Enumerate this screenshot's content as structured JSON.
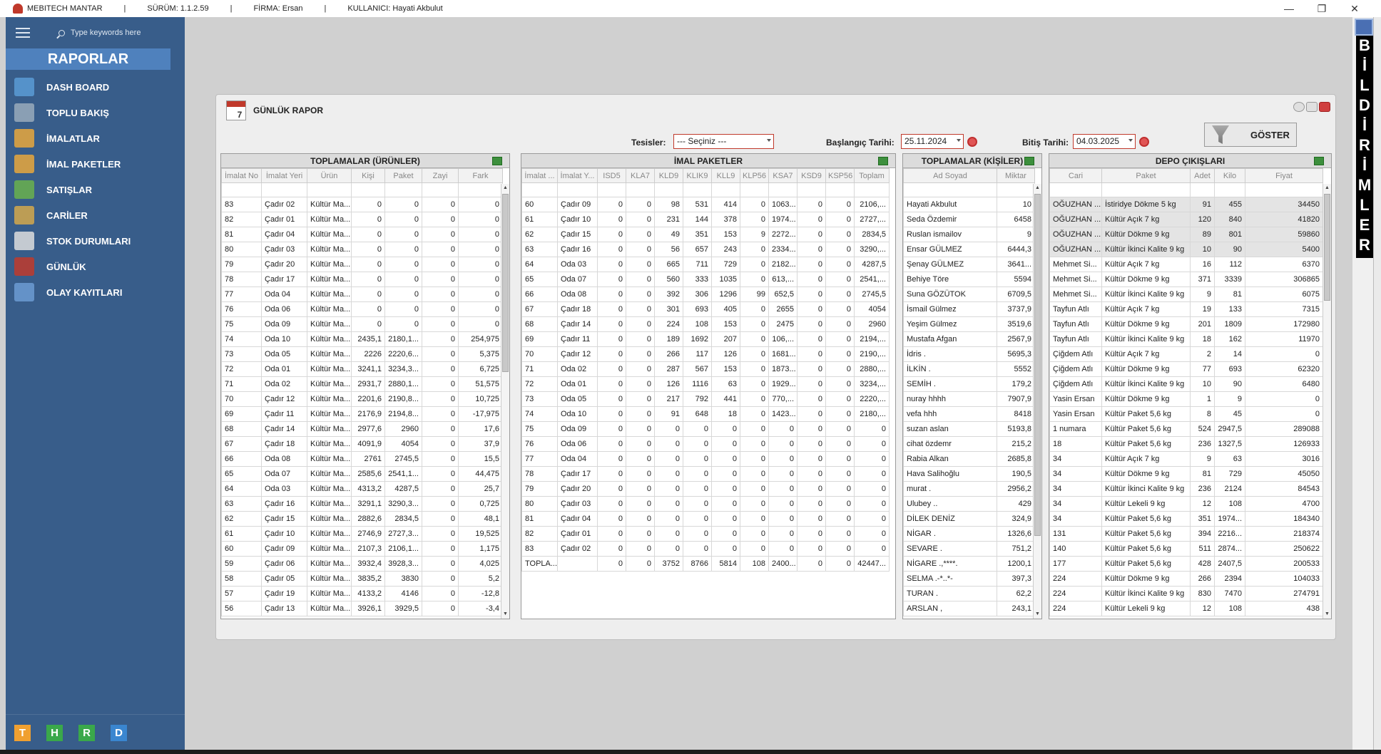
{
  "titlebar": {
    "app": "MEBITECH MANTAR",
    "sep": "|",
    "version": "SÜRÜM: 1.1.2.59",
    "company": "FİRMA: Ersan",
    "user": "KULLANICI: Hayati Akbulut",
    "min": "—",
    "max": "❐",
    "close": "✕"
  },
  "sidebar": {
    "search_placeholder": "Type keywords here",
    "header": "RAPORLAR",
    "items": [
      {
        "label": "DASH BOARD",
        "icon": "bar-chart-icon"
      },
      {
        "label": "TOPLU BAKIŞ",
        "icon": "overview-icon"
      },
      {
        "label": "İMALATLAR",
        "icon": "box-icon"
      },
      {
        "label": "İMAL PAKETLER",
        "icon": "boxes-icon"
      },
      {
        "label": "SATIŞLAR",
        "icon": "coins-icon"
      },
      {
        "label": "CARİLER",
        "icon": "people-icon"
      },
      {
        "label": "STOK DURUMLARI",
        "icon": "list-icon"
      },
      {
        "label": "GÜNLÜK",
        "icon": "calendar-icon"
      },
      {
        "label": "OLAY KAYITLARI",
        "icon": "film-icon"
      }
    ],
    "bottom": [
      {
        "label": "T",
        "color": "#f0a030"
      },
      {
        "label": "H",
        "color": "#3aa84a"
      },
      {
        "label": "R",
        "color": "#3aa84a"
      },
      {
        "label": "D",
        "color": "#3a86d0"
      }
    ]
  },
  "notify": {
    "letters": [
      "B",
      "İ",
      "L",
      "D",
      "İ",
      "R",
      "İ",
      "M",
      "L",
      "E",
      "R"
    ]
  },
  "report": {
    "title": "GÜNLÜK RAPOR",
    "cal_num": "7",
    "filters": {
      "tesisler_label": "Tesisler:",
      "tesisler_value": "--- Seçiniz ---",
      "start_label": "Başlangıç Tarihi:",
      "start_value": "25.11.2024",
      "end_label": "Bitiş Tarihi:",
      "end_value": "04.03.2025",
      "show_button": "GÖSTER"
    }
  },
  "grid1": {
    "title": "TOPLAMALAR (ÜRÜNLER)",
    "columns": [
      "İmalat No",
      "İmalat Yeri",
      "Ürün",
      "Kişi",
      "Paket",
      "Zayi",
      "Fark"
    ],
    "rows": [
      [
        "83",
        "Çadır 02",
        "Kültür Ma...",
        "0",
        "0",
        "0",
        "0"
      ],
      [
        "82",
        "Çadır 01",
        "Kültür Ma...",
        "0",
        "0",
        "0",
        "0"
      ],
      [
        "81",
        "Çadır 04",
        "Kültür Ma...",
        "0",
        "0",
        "0",
        "0"
      ],
      [
        "80",
        "Çadır 03",
        "Kültür Ma...",
        "0",
        "0",
        "0",
        "0"
      ],
      [
        "79",
        "Çadır 20",
        "Kültür Ma...",
        "0",
        "0",
        "0",
        "0"
      ],
      [
        "78",
        "Çadır 17",
        "Kültür Ma...",
        "0",
        "0",
        "0",
        "0"
      ],
      [
        "77",
        "Oda 04",
        "Kültür Ma...",
        "0",
        "0",
        "0",
        "0"
      ],
      [
        "76",
        "Oda 06",
        "Kültür Ma...",
        "0",
        "0",
        "0",
        "0"
      ],
      [
        "75",
        "Oda 09",
        "Kültür Ma...",
        "0",
        "0",
        "0",
        "0"
      ],
      [
        "74",
        "Oda 10",
        "Kültür Ma...",
        "2435,1",
        "2180,1...",
        "0",
        "254,975"
      ],
      [
        "73",
        "Oda 05",
        "Kültür Ma...",
        "2226",
        "2220,6...",
        "0",
        "5,375"
      ],
      [
        "72",
        "Oda 01",
        "Kültür Ma...",
        "3241,1",
        "3234,3...",
        "0",
        "6,725"
      ],
      [
        "71",
        "Oda 02",
        "Kültür Ma...",
        "2931,7",
        "2880,1...",
        "0",
        "51,575"
      ],
      [
        "70",
        "Çadır 12",
        "Kültür Ma...",
        "2201,6",
        "2190,8...",
        "0",
        "10,725"
      ],
      [
        "69",
        "Çadır 11",
        "Kültür Ma...",
        "2176,9",
        "2194,8...",
        "0",
        "-17,975"
      ],
      [
        "68",
        "Çadır 14",
        "Kültür Ma...",
        "2977,6",
        "2960",
        "0",
        "17,6"
      ],
      [
        "67",
        "Çadır 18",
        "Kültür Ma...",
        "4091,9",
        "4054",
        "0",
        "37,9"
      ],
      [
        "66",
        "Oda 08",
        "Kültür Ma...",
        "2761",
        "2745,5",
        "0",
        "15,5"
      ],
      [
        "65",
        "Oda 07",
        "Kültür Ma...",
        "2585,6",
        "2541,1...",
        "0",
        "44,475"
      ],
      [
        "64",
        "Oda 03",
        "Kültür Ma...",
        "4313,2",
        "4287,5",
        "0",
        "25,7"
      ],
      [
        "63",
        "Çadır 16",
        "Kültür Ma...",
        "3291,1",
        "3290,3...",
        "0",
        "0,725"
      ],
      [
        "62",
        "Çadır 15",
        "Kültür Ma...",
        "2882,6",
        "2834,5",
        "0",
        "48,1"
      ],
      [
        "61",
        "Çadır 10",
        "Kültür Ma...",
        "2746,9",
        "2727,3...",
        "0",
        "19,525"
      ],
      [
        "60",
        "Çadır 09",
        "Kültür Ma...",
        "2107,3",
        "2106,1...",
        "0",
        "1,175"
      ],
      [
        "59",
        "Çadır 06",
        "Kültür Ma...",
        "3932,4",
        "3928,3...",
        "0",
        "4,025"
      ],
      [
        "58",
        "Çadır 05",
        "Kültür Ma...",
        "3835,2",
        "3830",
        "0",
        "5,2"
      ],
      [
        "57",
        "Çadır 19",
        "Kültür Ma...",
        "4133,2",
        "4146",
        "0",
        "-12,8"
      ],
      [
        "56",
        "Çadır 13",
        "Kültür Ma...",
        "3926,1",
        "3929,5",
        "0",
        "-3,4"
      ]
    ]
  },
  "grid2": {
    "title": "İMAL PAKETLER",
    "columns": [
      "İmalat ...",
      "İmalat Y...",
      "ISD5",
      "KLA7",
      "KLD9",
      "KLIK9",
      "KLL9",
      "KLP56",
      "KSA7",
      "KSD9",
      "KSP56",
      "Toplam"
    ],
    "rows": [
      [
        "60",
        "Çadır 09",
        "0",
        "0",
        "98",
        "531",
        "414",
        "0",
        "1063...",
        "0",
        "0",
        "2106,..."
      ],
      [
        "61",
        "Çadır 10",
        "0",
        "0",
        "231",
        "144",
        "378",
        "0",
        "1974...",
        "0",
        "0",
        "2727,..."
      ],
      [
        "62",
        "Çadır 15",
        "0",
        "0",
        "49",
        "351",
        "153",
        "9",
        "2272...",
        "0",
        "0",
        "2834,5"
      ],
      [
        "63",
        "Çadır 16",
        "0",
        "0",
        "56",
        "657",
        "243",
        "0",
        "2334...",
        "0",
        "0",
        "3290,..."
      ],
      [
        "64",
        "Oda 03",
        "0",
        "0",
        "665",
        "711",
        "729",
        "0",
        "2182...",
        "0",
        "0",
        "4287,5"
      ],
      [
        "65",
        "Oda 07",
        "0",
        "0",
        "560",
        "333",
        "1035",
        "0",
        "613,...",
        "0",
        "0",
        "2541,..."
      ],
      [
        "66",
        "Oda 08",
        "0",
        "0",
        "392",
        "306",
        "1296",
        "99",
        "652,5",
        "0",
        "0",
        "2745,5"
      ],
      [
        "67",
        "Çadır 18",
        "0",
        "0",
        "301",
        "693",
        "405",
        "0",
        "2655",
        "0",
        "0",
        "4054"
      ],
      [
        "68",
        "Çadır 14",
        "0",
        "0",
        "224",
        "108",
        "153",
        "0",
        "2475",
        "0",
        "0",
        "2960"
      ],
      [
        "69",
        "Çadır 11",
        "0",
        "0",
        "189",
        "1692",
        "207",
        "0",
        "106,...",
        "0",
        "0",
        "2194,..."
      ],
      [
        "70",
        "Çadır 12",
        "0",
        "0",
        "266",
        "117",
        "126",
        "0",
        "1681...",
        "0",
        "0",
        "2190,..."
      ],
      [
        "71",
        "Oda 02",
        "0",
        "0",
        "287",
        "567",
        "153",
        "0",
        "1873...",
        "0",
        "0",
        "2880,..."
      ],
      [
        "72",
        "Oda 01",
        "0",
        "0",
        "126",
        "1116",
        "63",
        "0",
        "1929...",
        "0",
        "0",
        "3234,..."
      ],
      [
        "73",
        "Oda 05",
        "0",
        "0",
        "217",
        "792",
        "441",
        "0",
        "770,...",
        "0",
        "0",
        "2220,..."
      ],
      [
        "74",
        "Oda 10",
        "0",
        "0",
        "91",
        "648",
        "18",
        "0",
        "1423...",
        "0",
        "0",
        "2180,..."
      ],
      [
        "75",
        "Oda 09",
        "0",
        "0",
        "0",
        "0",
        "0",
        "0",
        "0",
        "0",
        "0",
        "0"
      ],
      [
        "76",
        "Oda 06",
        "0",
        "0",
        "0",
        "0",
        "0",
        "0",
        "0",
        "0",
        "0",
        "0"
      ],
      [
        "77",
        "Oda 04",
        "0",
        "0",
        "0",
        "0",
        "0",
        "0",
        "0",
        "0",
        "0",
        "0"
      ],
      [
        "78",
        "Çadır 17",
        "0",
        "0",
        "0",
        "0",
        "0",
        "0",
        "0",
        "0",
        "0",
        "0"
      ],
      [
        "79",
        "Çadır 20",
        "0",
        "0",
        "0",
        "0",
        "0",
        "0",
        "0",
        "0",
        "0",
        "0"
      ],
      [
        "80",
        "Çadır 03",
        "0",
        "0",
        "0",
        "0",
        "0",
        "0",
        "0",
        "0",
        "0",
        "0"
      ],
      [
        "81",
        "Çadır 04",
        "0",
        "0",
        "0",
        "0",
        "0",
        "0",
        "0",
        "0",
        "0",
        "0"
      ],
      [
        "82",
        "Çadır 01",
        "0",
        "0",
        "0",
        "0",
        "0",
        "0",
        "0",
        "0",
        "0",
        "0"
      ],
      [
        "83",
        "Çadır 02",
        "0",
        "0",
        "0",
        "0",
        "0",
        "0",
        "0",
        "0",
        "0",
        "0"
      ],
      [
        "TOPLA...",
        "",
        "0",
        "0",
        "3752",
        "8766",
        "5814",
        "108",
        "2400...",
        "0",
        "0",
        "42447..."
      ]
    ]
  },
  "grid3": {
    "title": "TOPLAMALAR (KİŞİLER)",
    "columns": [
      "Ad Soyad",
      "Miktar"
    ],
    "rows": [
      [
        "Hayati Akbulut",
        "10"
      ],
      [
        "Seda Özdemir",
        "6458"
      ],
      [
        "Ruslan ismailov",
        "9"
      ],
      [
        "Ensar GÜLMEZ",
        "6444,3"
      ],
      [
        "Şenay GÜLMEZ",
        "3641..."
      ],
      [
        "Behiye Töre",
        "5594"
      ],
      [
        "Suna GÖZÜTOK",
        "6709,5"
      ],
      [
        "İsmail Gülmez",
        "3737,9"
      ],
      [
        "Yeşim Gülmez",
        "3519,6"
      ],
      [
        "Mustafa Afgan",
        "2567,9"
      ],
      [
        "İdris .",
        "5695,3"
      ],
      [
        "İLKİN .",
        "5552"
      ],
      [
        "SEMİH .",
        "179,2"
      ],
      [
        "nuray hhhh",
        "7907,9"
      ],
      [
        "vefa hhh",
        "8418"
      ],
      [
        "suzan aslan",
        "5193,8"
      ],
      [
        "cihat özdemr",
        "215,2"
      ],
      [
        "Rabia Alkan",
        "2685,8"
      ],
      [
        "Hava Salihoğlu",
        "190,5"
      ],
      [
        "murat .",
        "2956,2"
      ],
      [
        "Ulubey ..",
        "429"
      ],
      [
        "DİLEK DENİZ",
        "324,9"
      ],
      [
        "NİGAR .",
        "1326,6"
      ],
      [
        "SEVARE .",
        "751,2"
      ],
      [
        "NİGARE .,****.",
        "1200,1"
      ],
      [
        "SELMA .-*..*-",
        "397,3"
      ],
      [
        "TURAN .",
        "62,2"
      ],
      [
        "ARSLAN ,",
        "243,1"
      ]
    ]
  },
  "grid4": {
    "title": "DEPO ÇIKIŞLARI",
    "columns": [
      "Cari",
      "Paket",
      "Adet",
      "Kilo",
      "Fiyat"
    ],
    "rows": [
      [
        "OĞUZHAN ...",
        "İstiridye Dökme 5 kg",
        "91",
        "455",
        "34450"
      ],
      [
        "OĞUZHAN ...",
        "Kültür Açık 7 kg",
        "120",
        "840",
        "41820"
      ],
      [
        "OĞUZHAN ...",
        "Kültür Dökme 9 kg",
        "89",
        "801",
        "59860"
      ],
      [
        "OĞUZHAN ...",
        "Kültür İkinci Kalite 9 kg",
        "10",
        "90",
        "5400"
      ],
      [
        "Mehmet Si...",
        "Kültür Açık 7 kg",
        "16",
        "112",
        "6370"
      ],
      [
        "Mehmet Si...",
        "Kültür Dökme 9 kg",
        "371",
        "3339",
        "306865"
      ],
      [
        "Mehmet Si...",
        "Kültür İkinci Kalite 9 kg",
        "9",
        "81",
        "6075"
      ],
      [
        "Tayfun Atlı",
        "Kültür Açık 7 kg",
        "19",
        "133",
        "7315"
      ],
      [
        "Tayfun Atlı",
        "Kültür Dökme 9 kg",
        "201",
        "1809",
        "172980"
      ],
      [
        "Tayfun Atlı",
        "Kültür İkinci Kalite 9 kg",
        "18",
        "162",
        "11970"
      ],
      [
        "Çiğdem Atlı",
        "Kültür Açık 7 kg",
        "2",
        "14",
        "0"
      ],
      [
        "Çiğdem Atlı",
        "Kültür Dökme 9 kg",
        "77",
        "693",
        "62320"
      ],
      [
        "Çiğdem Atlı",
        "Kültür İkinci Kalite 9 kg",
        "10",
        "90",
        "6480"
      ],
      [
        "Yasin Ersan",
        "Kültür Dökme 9 kg",
        "1",
        "9",
        "0"
      ],
      [
        "Yasin Ersan",
        "Kültür Paket 5,6 kg",
        "8",
        "45",
        "0"
      ],
      [
        "1 numara",
        "Kültür Paket 5,6 kg",
        "524",
        "2947,5",
        "289088"
      ],
      [
        "18",
        "Kültür Paket 5,6 kg",
        "236",
        "1327,5",
        "126933"
      ],
      [
        "34",
        "Kültür Açık 7 kg",
        "9",
        "63",
        "3016"
      ],
      [
        "34",
        "Kültür Dökme 9 kg",
        "81",
        "729",
        "45050"
      ],
      [
        "34",
        "Kültür İkinci Kalite 9 kg",
        "236",
        "2124",
        "84543"
      ],
      [
        "34",
        "Kültür Lekeli 9 kg",
        "12",
        "108",
        "4700"
      ],
      [
        "34",
        "Kültür Paket 5,6 kg",
        "351",
        "1974...",
        "184340"
      ],
      [
        "131",
        "Kültür Paket 5,6 kg",
        "394",
        "2216...",
        "218374"
      ],
      [
        "140",
        "Kültür Paket 5,6 kg",
        "511",
        "2874...",
        "250622"
      ],
      [
        "177",
        "Kültür Paket 5,6 kg",
        "428",
        "2407,5",
        "200533"
      ],
      [
        "224",
        "Kültür Dökme 9 kg",
        "266",
        "2394",
        "104033"
      ],
      [
        "224",
        "Kültür İkinci Kalite 9 kg",
        "830",
        "7470",
        "274791"
      ],
      [
        "224",
        "Kültür Lekeli 9 kg",
        "12",
        "108",
        "438"
      ]
    ]
  }
}
